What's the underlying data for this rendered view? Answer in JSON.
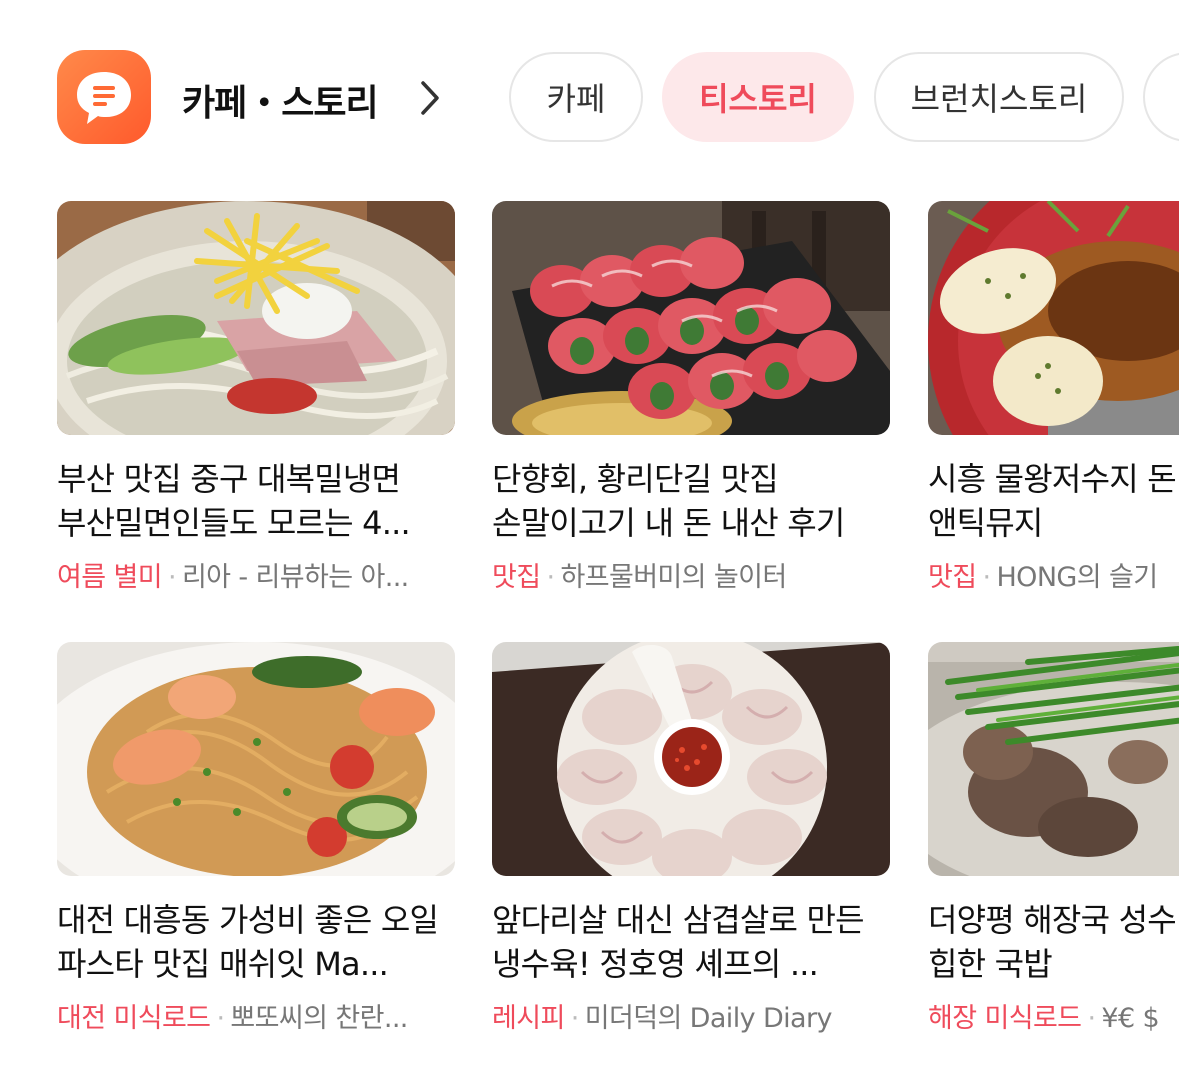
{
  "header": {
    "title": "카페・스토리",
    "chips": [
      "카페",
      "티스토리",
      "브런치스토리"
    ],
    "active_chip": "티스토리"
  },
  "colors": {
    "accent": "#ef4b5b",
    "chip_active_bg": "#fde8ea",
    "app_icon": "#ff6a35"
  },
  "cards": [
    {
      "title": "부산 맛집 중구 대복밀냉면 부산밀면인들도 모르는 4...",
      "category": "여름 별미",
      "source": "리아 - 리뷰하는 아...",
      "image": "naengmyeon-photo"
    },
    {
      "title": "단향회, 황리단길 맛집 손말이고기 내 돈 내산 후기",
      "category": "맛집",
      "source": "하프물버미의 놀이터",
      "image": "beef-rolls-photo"
    },
    {
      "title": "시흥 물왕저수지 돈 스타 맛집 앤틱뮤지",
      "category": "맛집",
      "source": "HONG의 슬기",
      "image": "tonkatsu-photo"
    },
    {
      "title": "대전 대흥동 가성비 좋은 오일 파스타 맛집 매쉬잇 Ma...",
      "category": "대전 미식로드",
      "source": "뽀또씨의 찬란...",
      "image": "pasta-photo"
    },
    {
      "title": "앞다리살 대신 삼겹살로 만든 냉수육! 정호영 셰프의 ...",
      "category": "레시피",
      "source": "미더덕의 Daily Diary",
      "image": "suyuk-photo"
    },
    {
      "title": "더양평 해장국 성수 이 진하게 힙한 국밥",
      "category": "해장 미식로드",
      "source": "¥€ $",
      "image": "haejangguk-photo"
    }
  ]
}
